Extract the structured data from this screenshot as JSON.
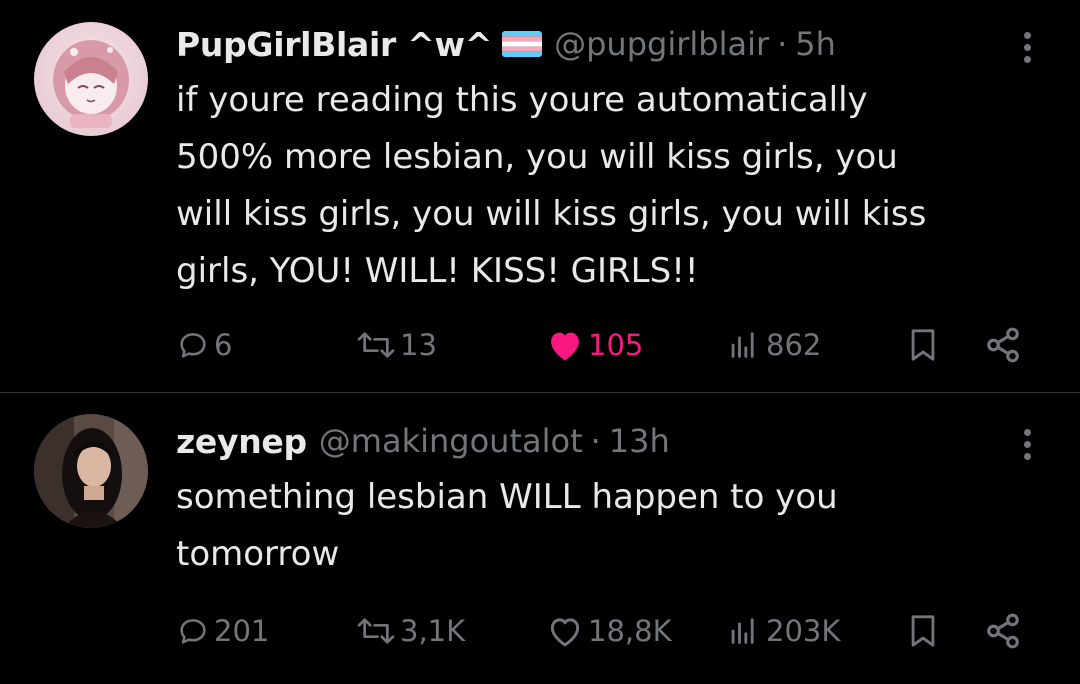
{
  "tweets": [
    {
      "display_name": "PupGirlBlair ^w^",
      "flag_icon": "trans-flag-icon",
      "handle": "@pupgirlblair",
      "separator": "·",
      "time": "5h",
      "text": "if youre reading this youre automatically\n500% more lesbian, you will kiss girls, you\nwill kiss girls, you will kiss girls, you will kiss\ngirls, YOU! WILL! KISS! GIRLS!!",
      "replies": "6",
      "reposts": "13",
      "likes": "105",
      "liked": true,
      "views": "862",
      "like_color": "#f91880"
    },
    {
      "display_name": "zeynep",
      "handle": "@makingoutalot",
      "separator": "·",
      "time": "13h",
      "text": "something lesbian WILL happen to you\ntomorrow",
      "replies": "201",
      "reposts": "3,1K",
      "likes": "18,8K",
      "liked": false,
      "views": "203K"
    }
  ],
  "colors": {
    "background": "#000000",
    "text": "#e7e9ea",
    "muted": "#71767b",
    "divider": "#2f3336",
    "like": "#f91880"
  }
}
